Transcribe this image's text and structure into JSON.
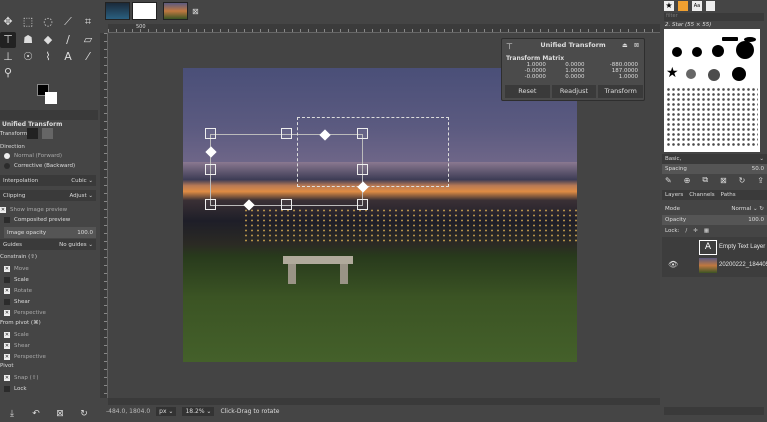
{
  "tool_options": {
    "title": "Unified Transform",
    "transform_label": "Transform:",
    "direction_label": "Direction",
    "direction_normal": "Normal (Forward)",
    "direction_corrective": "Corrective (Backward)",
    "interpolation_label": "Interpolation",
    "interpolation_value": "Cubic",
    "clipping_label": "Clipping",
    "clipping_value": "Adjust",
    "show_preview": "Show image preview",
    "composited_preview": "Composited preview",
    "opacity_label": "Image opacity",
    "opacity_value": "100.0",
    "guides_label": "Guides",
    "guides_value": "No guides",
    "constrain_label": "Constrain (⇧)",
    "constrain": [
      {
        "label": "Move",
        "on": true
      },
      {
        "label": "Scale",
        "on": false
      },
      {
        "label": "Rotate",
        "on": true
      },
      {
        "label": "Shear",
        "on": false
      },
      {
        "label": "Perspective",
        "on": true
      }
    ],
    "from_pivot_label": "From pivot (⌘)",
    "from_pivot": [
      {
        "label": "Scale",
        "on": true
      },
      {
        "label": "Shear",
        "on": true
      },
      {
        "label": "Perspective",
        "on": true
      }
    ],
    "pivot_label": "Pivot",
    "pivot": [
      {
        "label": "Snap (⇧)",
        "on": true
      },
      {
        "label": "Lock",
        "on": false
      }
    ]
  },
  "ruler": {
    "mark_500": "500"
  },
  "dialog": {
    "title": "Unified Transform",
    "matrix_title": "Transform Matrix",
    "matrix": [
      [
        "1.0000",
        "0.0000",
        "-880.0000"
      ],
      [
        "-0.0000",
        "1.0000",
        "187.0000"
      ],
      [
        "-0.0000",
        "0.0000",
        "1.0000"
      ]
    ],
    "reset": "Reset",
    "readjust": "Readjust",
    "transform": "Transform"
  },
  "status": {
    "coords": "-484.0, 1804.0",
    "unit": "px",
    "zoom": "18.2%",
    "message": "Click-Drag to rotate"
  },
  "right_dock": {
    "filter_placeholder": "filter",
    "brush_name": "2. Star (55 × 55)",
    "brush_set": "Basic,",
    "spacing_label": "Spacing",
    "spacing_value": "50.0",
    "tab_layers": "Layers",
    "tab_channels": "Channels",
    "tab_paths": "Paths",
    "mode_label": "Mode",
    "mode_value": "Normal",
    "opacity_label": "Opacity",
    "opacity_value": "100.0",
    "lock_label": "Lock:",
    "layers": [
      {
        "name": "Empty Text Layer"
      },
      {
        "name": "20200222_184405"
      }
    ]
  }
}
